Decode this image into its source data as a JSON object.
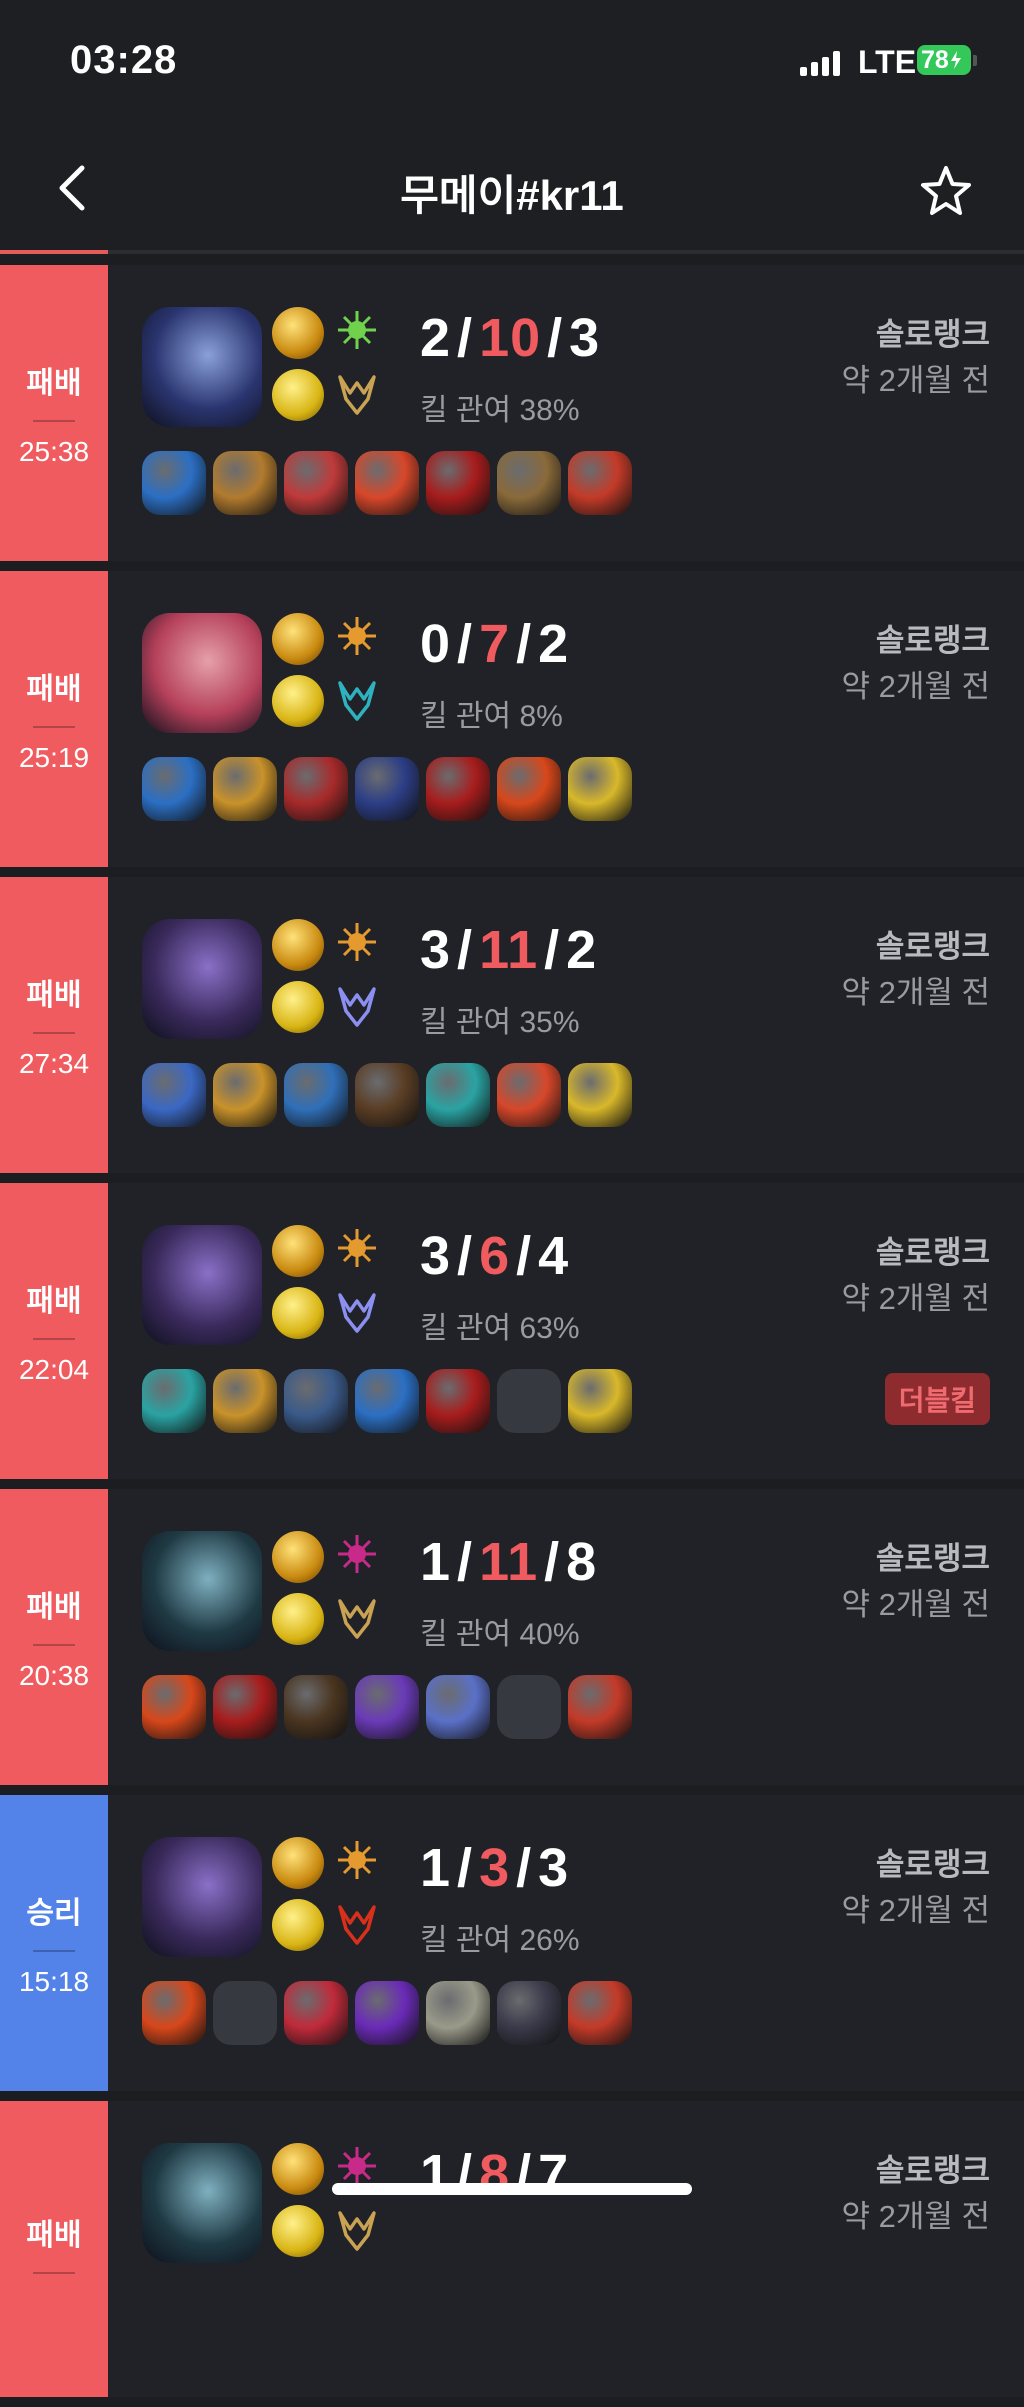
{
  "status": {
    "time": "03:28",
    "network": "LTE",
    "battery": "78"
  },
  "header": {
    "title": "무메이#kr11"
  },
  "matches": [
    {
      "result": "패배",
      "type": "loss",
      "duration": "25:38",
      "kills": "2",
      "deaths": "10",
      "assists": "3",
      "kill_participation": "킬 관여 38%",
      "queue": "솔로랭크",
      "ago": "약 2개월 전",
      "badge": "",
      "champ_colors": [
        "#2a3570",
        "#8aa0d8"
      ],
      "spells": [
        "#2aa5d6",
        "#c8861d"
      ],
      "rune_sec": [
        "#6fd14c",
        "#c9a253"
      ],
      "items": [
        "#2b6fc4",
        "#b27b2e",
        "#c03a3a",
        "#d8472a",
        "#a81c1c",
        "#8a6a3a",
        "#c43a28"
      ]
    },
    {
      "result": "패배",
      "type": "loss",
      "duration": "25:19",
      "kills": "0",
      "deaths": "7",
      "assists": "2",
      "kill_participation": "킬 관여 8%",
      "queue": "솔로랭크",
      "ago": "약 2개월 전",
      "badge": "",
      "champ_colors": [
        "#b5405a",
        "#e5a0a8"
      ],
      "spells": [
        "#2aa5d6",
        "#d89a20"
      ],
      "rune_sec": [
        "#e49a2e",
        "#2fb2c0"
      ],
      "items": [
        "#2b6fc4",
        "#c9922a",
        "#a82a2a",
        "#2c3e86",
        "#a81c1c",
        "#d8471a",
        "#d9b82a"
      ]
    },
    {
      "result": "패배",
      "type": "loss",
      "duration": "27:34",
      "kills": "3",
      "deaths": "11",
      "assists": "2",
      "kill_participation": "킬 관여 35%",
      "queue": "솔로랭크",
      "ago": "약 2개월 전",
      "badge": "",
      "champ_colors": [
        "#3a2a5c",
        "#8a70c8"
      ],
      "spells": [
        "#2a6fd6",
        "#c8861d"
      ],
      "rune_sec": [
        "#e49a2e",
        "#8a8ff0"
      ],
      "items": [
        "#3a68c4",
        "#c9922a",
        "#2f6fb8",
        "#5a3d24",
        "#2aa3a3",
        "#d8472a",
        "#d9b82a"
      ]
    },
    {
      "result": "패배",
      "type": "loss",
      "duration": "22:04",
      "kills": "3",
      "deaths": "6",
      "assists": "4",
      "kill_participation": "킬 관여 63%",
      "queue": "솔로랭크",
      "ago": "약 2개월 전",
      "badge": "더블킬",
      "champ_colors": [
        "#3a2a5c",
        "#8a70c8"
      ],
      "spells": [
        "#2aa3a3",
        "#c9922a"
      ],
      "rune_sec": [
        "#e49a2e",
        "#8a8ff0"
      ],
      "items": [
        "#2aa3a3",
        "#c9922a",
        "#3a5a8a",
        "#2b6fc4",
        "#a81c1c",
        "",
        "#d9b82a"
      ]
    },
    {
      "result": "패배",
      "type": "loss",
      "duration": "20:38",
      "kills": "1",
      "deaths": "11",
      "assists": "8",
      "kill_participation": "킬 관여 40%",
      "queue": "솔로랭크",
      "ago": "약 2개월 전",
      "badge": "",
      "champ_colors": [
        "#1f3a44",
        "#7fb0c0"
      ],
      "spells": [
        "#d8471a",
        "#a81c1c"
      ],
      "rune_sec": [
        "#c82a8a",
        "#c9a253"
      ],
      "items": [
        "#d8471a",
        "#a81c1c",
        "#4a3520",
        "#6a3ab8",
        "#5a70c8",
        "",
        "#c43a28"
      ]
    },
    {
      "result": "승리",
      "type": "win",
      "duration": "15:18",
      "kills": "1",
      "deaths": "3",
      "assists": "3",
      "kill_participation": "킬 관여 26%",
      "queue": "솔로랭크",
      "ago": "약 2개월 전",
      "badge": "",
      "champ_colors": [
        "#3a2a5c",
        "#8a70c8"
      ],
      "spells": [
        "#d8471a",
        ""
      ],
      "rune_sec": [
        "#e49a2e",
        "#d8301a"
      ],
      "items": [
        "#d8471a",
        "",
        "#c02a3a",
        "#6a2ab8",
        "#9a9a8a",
        "#3a3a4a",
        "#c43a28"
      ]
    },
    {
      "result": "패배",
      "type": "loss",
      "duration": "",
      "kills": "1",
      "deaths": "8",
      "assists": "7",
      "kill_participation": "",
      "queue": "솔로랭크",
      "ago": "약 2개월 전",
      "badge": "",
      "champ_colors": [
        "#1f3a44",
        "#7fb0c0"
      ],
      "spells": [
        "",
        ""
      ],
      "rune_sec": [
        "#c82a8a",
        "#c9a253"
      ],
      "items": []
    }
  ],
  "kda_separator": "/"
}
